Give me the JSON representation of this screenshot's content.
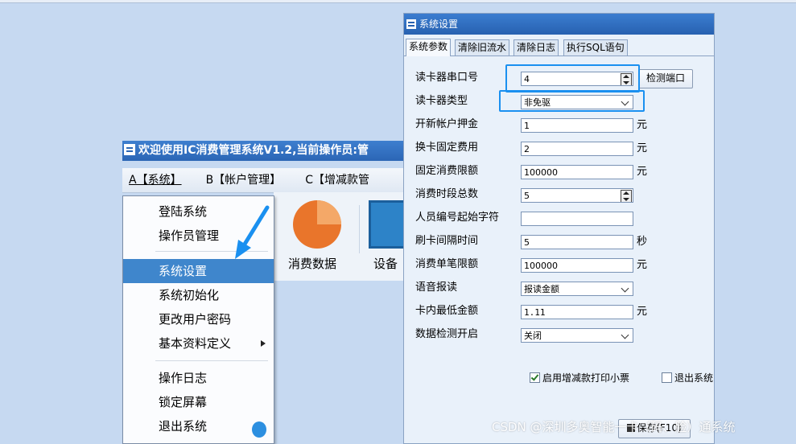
{
  "main_window": {
    "title": "欢迎使用IC消费管理系统V1.2,当前操作员:管",
    "menu": [
      "A【系统】",
      "B【帐户管理】",
      "C【增减款管"
    ],
    "toolbar": [
      "消费数据",
      "设备"
    ]
  },
  "dropdown": {
    "items": [
      "登陆系统",
      "操作员管理",
      "系统设置",
      "系统初始化",
      "更改用户密码",
      "基本资料定义",
      "操作日志",
      "锁定屏幕",
      "退出系统"
    ],
    "selected": "系统设置"
  },
  "dialog": {
    "title": "系统设置",
    "tabs": [
      "系统参数",
      "清除旧流水",
      "清除日志",
      "执行SQL语句"
    ],
    "fields": [
      {
        "label": "读卡器串口号",
        "value": "4",
        "unit": ""
      },
      {
        "label": "读卡器类型",
        "value": "非免驱",
        "unit": ""
      },
      {
        "label": "开新帐户押金",
        "value": "1",
        "unit": "元"
      },
      {
        "label": "换卡固定费用",
        "value": "2",
        "unit": "元"
      },
      {
        "label": "固定消费限额",
        "value": "100000",
        "unit": "元"
      },
      {
        "label": "消费时段总数",
        "value": "5",
        "unit": ""
      },
      {
        "label": "人员编号起始字符",
        "value": "",
        "unit": ""
      },
      {
        "label": "刷卡间隔时间",
        "value": "5",
        "unit": "秒"
      },
      {
        "label": "消费单笔限额",
        "value": "100000",
        "unit": "元"
      },
      {
        "label": "语音报读",
        "value": "报读金额",
        "unit": ""
      },
      {
        "label": "卡内最低金额",
        "value": "1.11",
        "unit": "元"
      },
      {
        "label": "数据检测开启",
        "value": "关闭",
        "unit": ""
      }
    ],
    "detect_port_button": "检测端口",
    "print_receipt_checkbox": {
      "label": "启用增减款打印小票",
      "checked": true
    },
    "exit_system_checkbox": {
      "label": "退出系统",
      "checked": false
    },
    "save_button": "保存(F10)"
  },
  "watermark": "CSDN @深圳多奥智能一卡（码、脸）通系统",
  "colors": {
    "highlight": "#1a90f0",
    "title_bar": "#2b66b5",
    "selected_menu": "#3f86cc"
  }
}
